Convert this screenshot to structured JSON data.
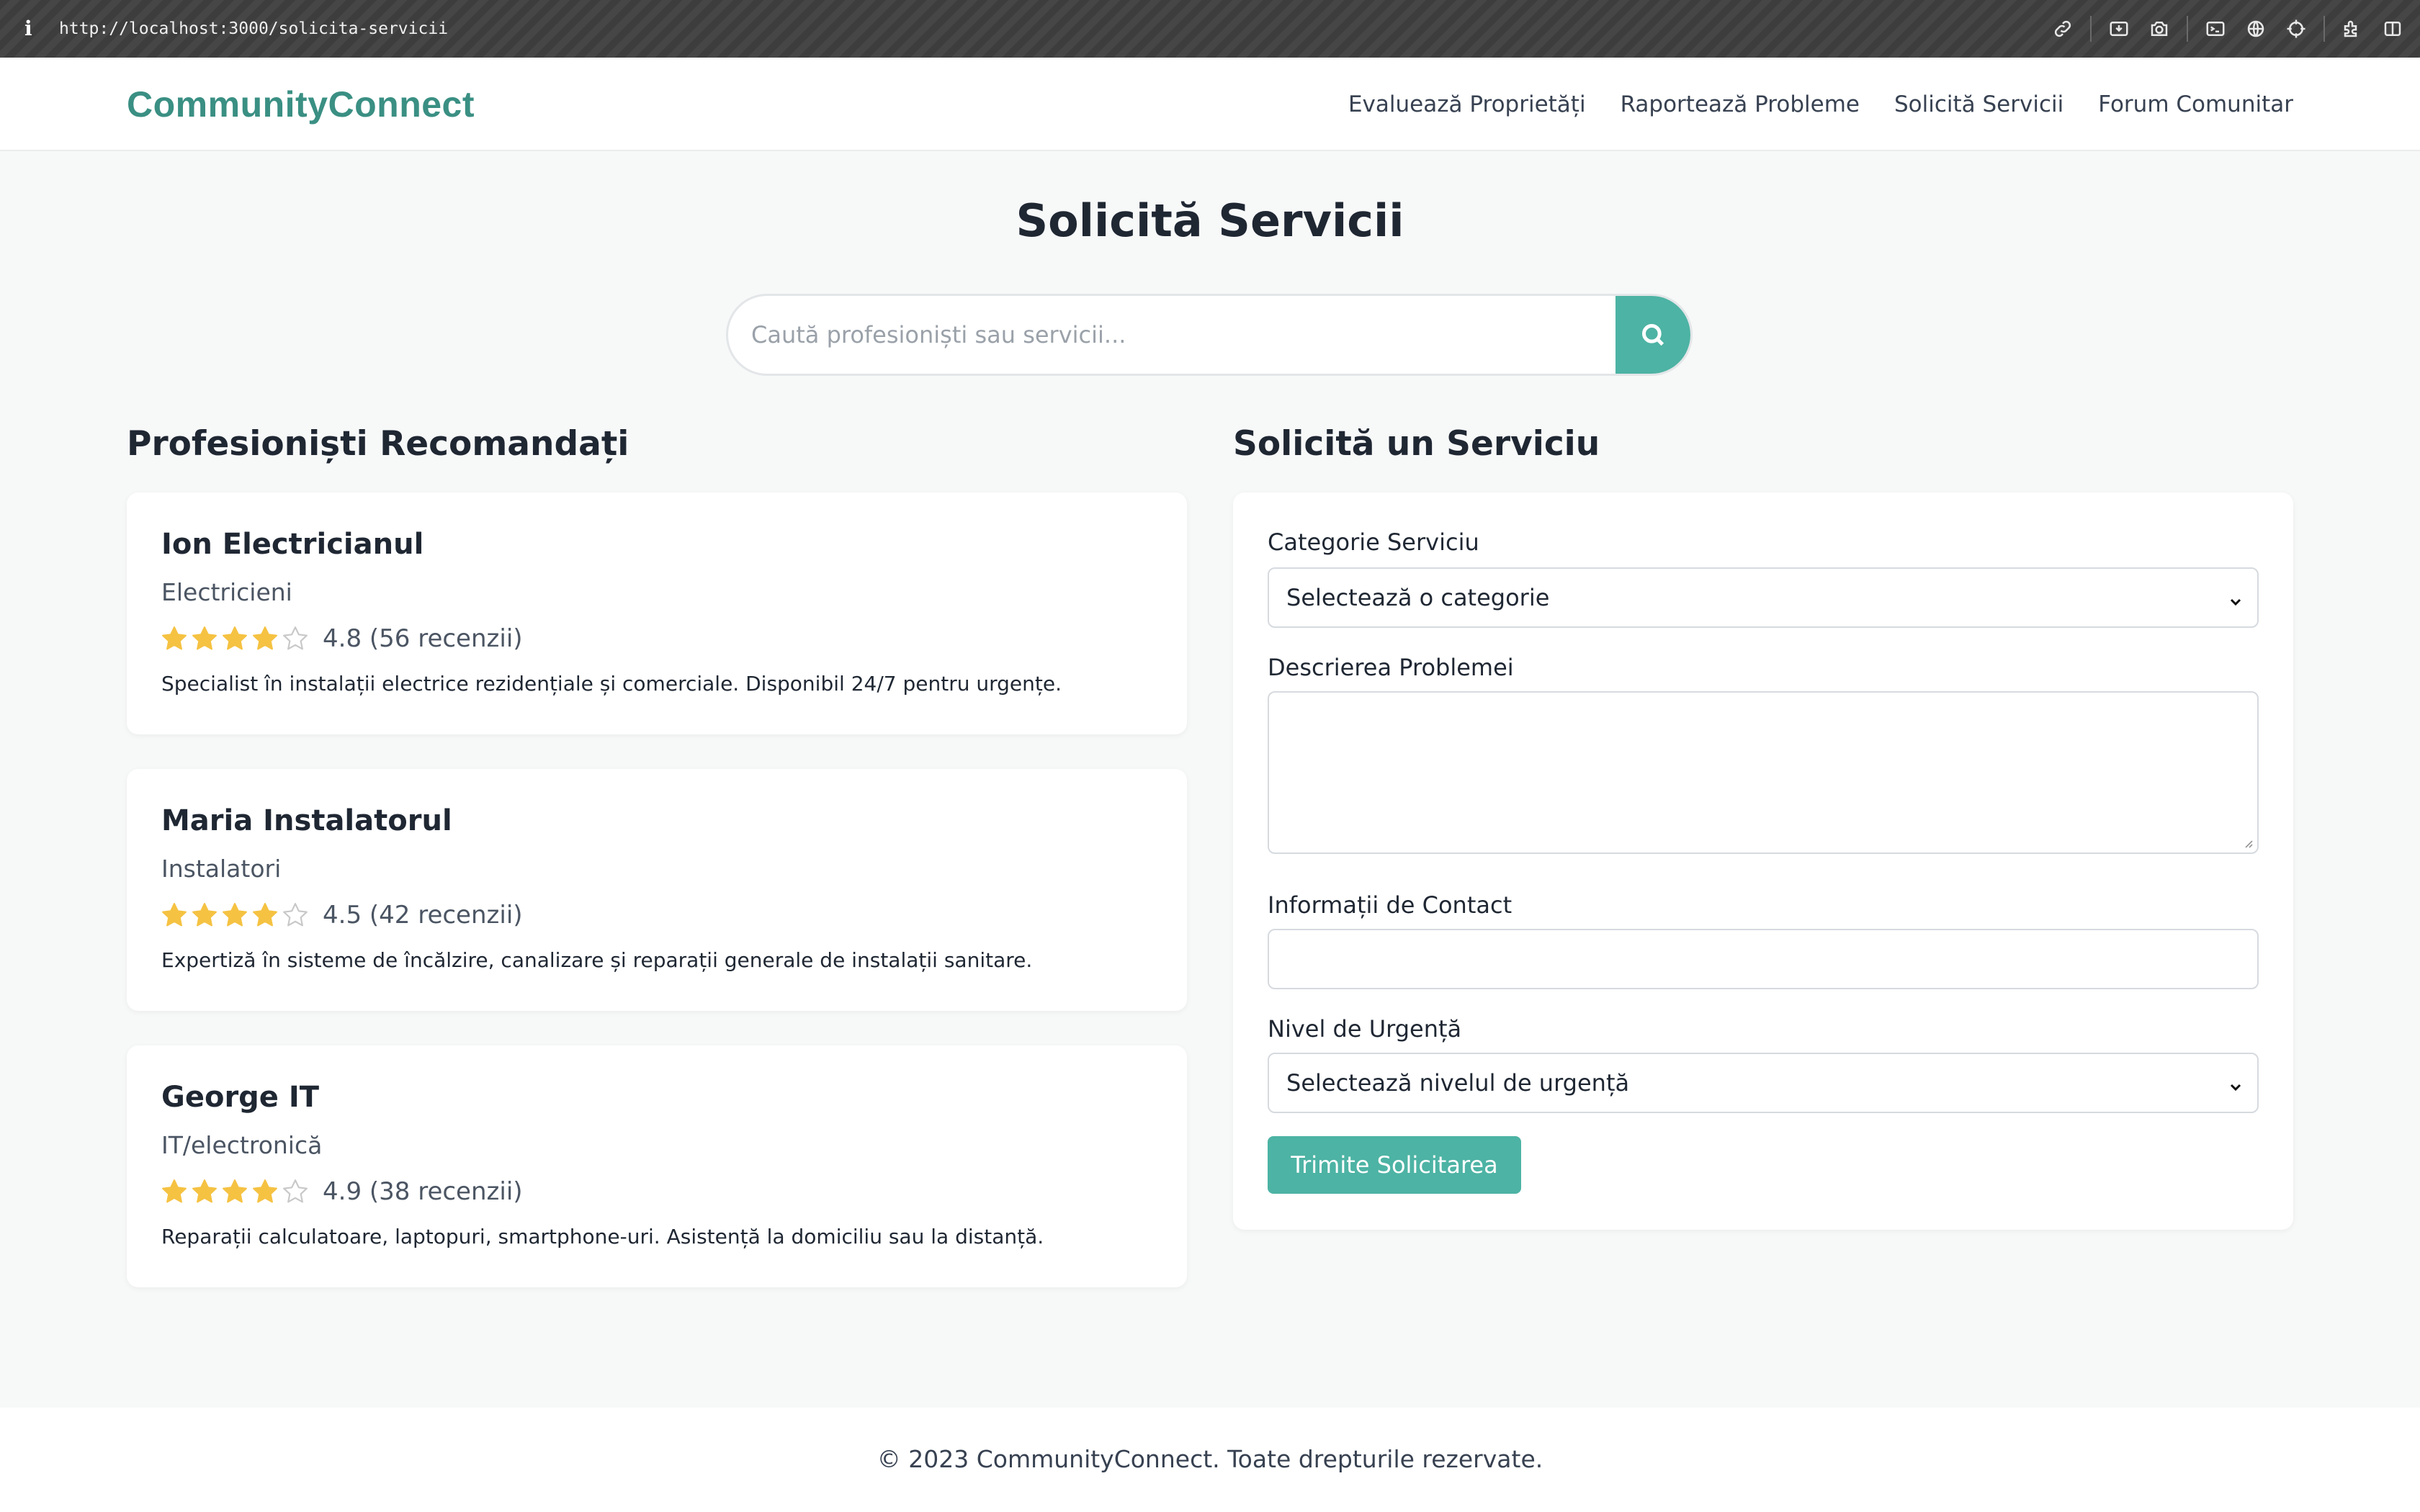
{
  "browser": {
    "info_glyph": "i",
    "url": "http://localhost:3000/solicita-servicii"
  },
  "header": {
    "logo": "CommunityConnect",
    "nav": [
      {
        "label": "Evaluează Proprietăți"
      },
      {
        "label": "Raportează Probleme"
      },
      {
        "label": "Solicită Servicii"
      },
      {
        "label": "Forum Comunitar"
      }
    ]
  },
  "main": {
    "title": "Solicită Servicii",
    "search": {
      "placeholder": "Caută profesioniști sau servicii...",
      "value": ""
    },
    "professionals": {
      "title": "Profesioniști Recomandați",
      "items": [
        {
          "name": "Ion Electricianul",
          "category": "Electricieni",
          "rating_value": 4.8,
          "stars_filled": 4,
          "rating_text": "4.8 (56 recenzii)",
          "description": "Specialist în instalații electrice rezidențiale și comerciale. Disponibil 24/7 pentru urgențe."
        },
        {
          "name": "Maria Instalatorul",
          "category": "Instalatori",
          "rating_value": 4.5,
          "stars_filled": 4,
          "rating_text": "4.5 (42 recenzii)",
          "description": "Expertiză în sisteme de încălzire, canalizare și reparații generale de instalații sanitare."
        },
        {
          "name": "George IT",
          "category": "IT/electronică",
          "rating_value": 4.9,
          "stars_filled": 4,
          "rating_text": "4.9 (38 recenzii)",
          "description": "Reparații calculatoare, laptopuri, smartphone-uri. Asistență la domiciliu sau la distanță."
        }
      ]
    },
    "request_form": {
      "title": "Solicită un Serviciu",
      "category_label": "Categorie Serviciu",
      "category_value": "Selectează o categorie",
      "description_label": "Descrierea Problemei",
      "description_value": "",
      "contact_label": "Informații de Contact",
      "contact_value": "",
      "urgency_label": "Nivel de Urgență",
      "urgency_value": "Selectează nivelul de urgență",
      "submit_label": "Trimite Solicitarea"
    }
  },
  "footer": {
    "text": "© 2023 CommunityConnect. Toate drepturile rezervate."
  },
  "colors": {
    "brand": "#3a8f83",
    "accent": "#4db3a4",
    "star": "#f5c242",
    "star_empty": "#c8c8c8"
  },
  "icons": {
    "browser_tools": [
      "link-icon",
      "download-icon",
      "camera-icon",
      "terminal-icon",
      "globe-icon",
      "crosshair-icon",
      "extension-icon",
      "sidebar-icon"
    ],
    "search": "search-icon",
    "select_arrow": "chevron-down-icon",
    "rating": "star-icon"
  }
}
